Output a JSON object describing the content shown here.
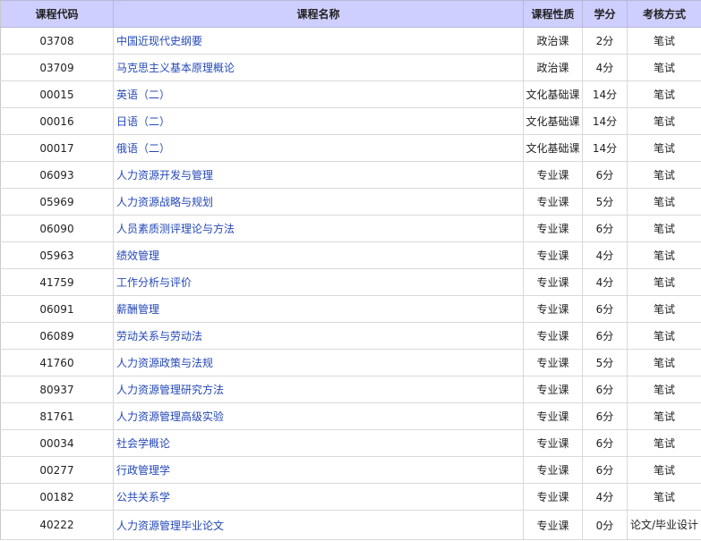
{
  "table": {
    "headers": {
      "code": "课程代码",
      "name": "课程名称",
      "type": "课程性质",
      "credit": "学分",
      "exam": "考核方式"
    },
    "rows": [
      {
        "code": "03708",
        "name": "中国近现代史纲要",
        "type": "政治课",
        "credit": "2分",
        "exam": "笔试"
      },
      {
        "code": "03709",
        "name": "马克思主义基本原理概论",
        "type": "政治课",
        "credit": "4分",
        "exam": "笔试"
      },
      {
        "code": "00015",
        "name": "英语（二）",
        "type": "文化基础课",
        "credit": "14分",
        "exam": "笔试"
      },
      {
        "code": "00016",
        "name": "日语（二）",
        "type": "文化基础课",
        "credit": "14分",
        "exam": "笔试"
      },
      {
        "code": "00017",
        "name": "俄语（二）",
        "type": "文化基础课",
        "credit": "14分",
        "exam": "笔试"
      },
      {
        "code": "06093",
        "name": "人力资源开发与管理",
        "type": "专业课",
        "credit": "6分",
        "exam": "笔试"
      },
      {
        "code": "05969",
        "name": "人力资源战略与规划",
        "type": "专业课",
        "credit": "5分",
        "exam": "笔试"
      },
      {
        "code": "06090",
        "name": "人员素质测评理论与方法",
        "type": "专业课",
        "credit": "6分",
        "exam": "笔试"
      },
      {
        "code": "05963",
        "name": "绩效管理",
        "type": "专业课",
        "credit": "4分",
        "exam": "笔试"
      },
      {
        "code": "41759",
        "name": "工作分析与评价",
        "type": "专业课",
        "credit": "4分",
        "exam": "笔试"
      },
      {
        "code": "06091",
        "name": "薪酬管理",
        "type": "专业课",
        "credit": "6分",
        "exam": "笔试"
      },
      {
        "code": "06089",
        "name": "劳动关系与劳动法",
        "type": "专业课",
        "credit": "6分",
        "exam": "笔试"
      },
      {
        "code": "41760",
        "name": "人力资源政策与法规",
        "type": "专业课",
        "credit": "5分",
        "exam": "笔试"
      },
      {
        "code": "80937",
        "name": "人力资源管理研究方法",
        "type": "专业课",
        "credit": "6分",
        "exam": "笔试"
      },
      {
        "code": "81761",
        "name": "人力资源管理高级实验",
        "type": "专业课",
        "credit": "6分",
        "exam": "笔试"
      },
      {
        "code": "00034",
        "name": "社会学概论",
        "type": "专业课",
        "credit": "6分",
        "exam": "笔试"
      },
      {
        "code": "00277",
        "name": "行政管理学",
        "type": "专业课",
        "credit": "6分",
        "exam": "笔试"
      },
      {
        "code": "00182",
        "name": "公共关系学",
        "type": "专业课",
        "credit": "4分",
        "exam": "笔试"
      },
      {
        "code": "40222",
        "name": "人力资源管理毕业论文",
        "type": "专业课",
        "credit": "0分",
        "exam": "论文/毕业设计"
      }
    ]
  },
  "colors": {
    "header_bg": "#cfcfff",
    "link": "#2448b8",
    "border": "#d9d9d9"
  }
}
